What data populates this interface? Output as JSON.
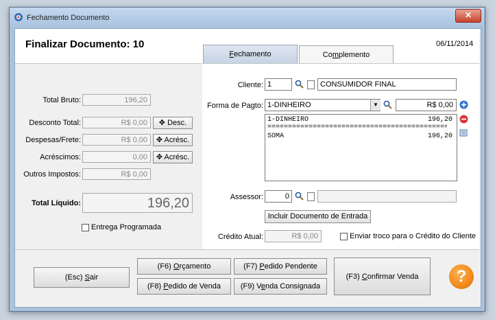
{
  "window": {
    "title": "Fechamento Documento",
    "close_glyph": "✕"
  },
  "header": {
    "title": "Finalizar Documento: 10",
    "date": "06/11/2014"
  },
  "tabs": [
    {
      "label_u": "F",
      "label_rest": "echamento",
      "active": true
    },
    {
      "label_pre": "Co",
      "label_u": "m",
      "label_rest": "plemento",
      "active": false
    }
  ],
  "totals": {
    "total_bruto_label": "Total Bruto:",
    "total_bruto_value": "196,20",
    "desconto_label": "Desconto Total:",
    "desconto_value": "R$ 0,00",
    "desconto_button": "Desc.",
    "despesas_label": "Despesas/Frete:",
    "despesas_value": "R$ 0,00",
    "despesas_button": "Acrésc.",
    "acrescimos_label": "Acréscimos:",
    "acrescimos_value": "0,00",
    "acrescimos_button": "Acrésc.",
    "impostos_label": "Outros Impostos:",
    "impostos_value": "R$ 0,00",
    "liquido_label": "Total Líquido:",
    "liquido_value": "196,20",
    "entrega_label": "Entrega Programada"
  },
  "cliente": {
    "label": "Cliente:",
    "code": "1",
    "name": "CONSUMIDOR FINAL"
  },
  "pagamento": {
    "label": "Forma de Pagto:",
    "selected": "1-DINHEIRO",
    "amount": "R$ 0,00",
    "list": [
      {
        "desc": "1-DINHEIRO",
        "value": "196,20"
      },
      {
        "desc": "=====================================================",
        "value": ""
      },
      {
        "desc": "SOMA",
        "value": "196,20"
      }
    ]
  },
  "assessor": {
    "label": "Assessor:",
    "code": "0",
    "name": ""
  },
  "incluir_button": "Incluir Documento de Entrada",
  "credito": {
    "label": "Crédito Atual:",
    "value": "R$ 0,00",
    "troco_label": "Enviar troco para o Crédito do Cliente"
  },
  "buttons": {
    "sair_pre": "(Esc) ",
    "sair_u": "S",
    "sair_rest": "air",
    "orcamento_pre": "(F6) ",
    "orcamento_u": "O",
    "orcamento_rest": "rçamento",
    "pendente_pre": "(F7) ",
    "pendente_u": "P",
    "pendente_rest": "edido Pendente",
    "pedido_pre": "(F8) ",
    "pedido_u": "P",
    "pedido_rest": "edido de Venda",
    "consignada_pre": "(F9) V",
    "consignada_u": "e",
    "consignada_rest": "nda Consignada",
    "confirmar_pre": "(F3) ",
    "confirmar_u": "C",
    "confirmar_rest": "onfirmar Venda",
    "help": "?"
  },
  "icons": {
    "search": "search-icon",
    "blank": "document-icon",
    "add": "plus-circle-icon",
    "remove": "minus-circle-icon",
    "list": "list-icon",
    "help": "help-icon"
  },
  "colors": {
    "accent_blue": "#2f6fd0",
    "remove_red": "#d83a3a",
    "help_orange": "#f08a1c"
  }
}
